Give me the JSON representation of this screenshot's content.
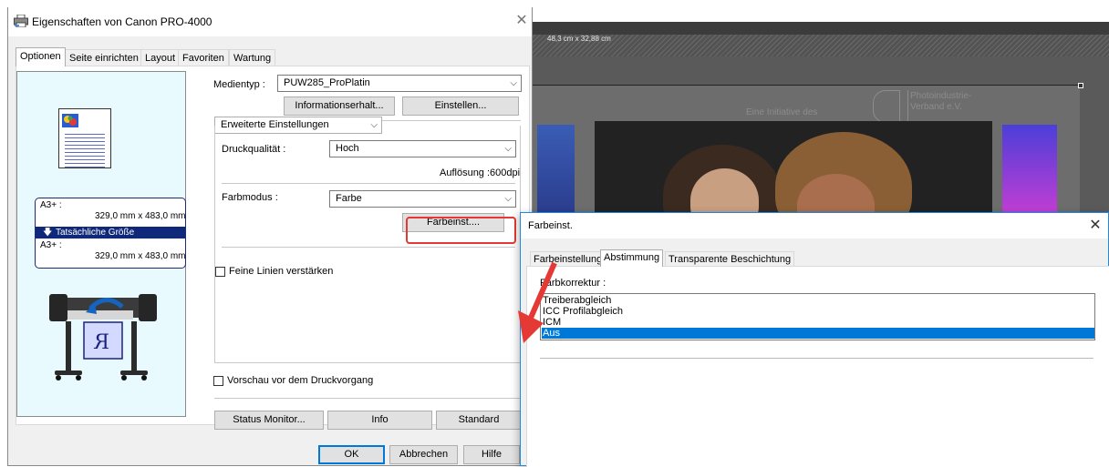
{
  "background": {
    "canvas_size": "48,3 cm x 32,88 cm",
    "slogan": "Eine Initiative des",
    "brand_line1": "Photoindustrie-",
    "brand_line2": "Verband e.V."
  },
  "properties_dialog": {
    "title": "Eigenschaften von Canon PRO-4000",
    "tabs": [
      "Optionen",
      "Seite einrichten",
      "Layout",
      "Favoriten",
      "Wartung"
    ],
    "active_tab": "Optionen",
    "preview": {
      "paper_label_1": "A3+ :",
      "paper_size_1": "329,0 mm x 483,0 mm",
      "scaling": "Tatsächliche Größe",
      "paper_label_2": "A3+ :",
      "paper_size_2": "329,0 mm x 483,0 mm"
    },
    "media_type_label": "Medientyp :",
    "media_type_value": "PUW285_ProPlatin",
    "info_button": "Informationserhalt...",
    "set_button": "Einstellen...",
    "settings_mode": "Erweiterte Einstellungen",
    "quality_label": "Druckqualität :",
    "quality_value": "Hoch",
    "resolution": "Auflösung :600dpi",
    "color_mode_label": "Farbmodus :",
    "color_mode_value": "Farbe",
    "color_settings_button": "Farbeinst....",
    "fine_lines_label": "Feine Linien verstärken",
    "fine_lines_checked": false,
    "preview_before_print_label": "Vorschau vor dem Druckvorgang",
    "preview_before_print_checked": false,
    "status_monitor_button": "Status Monitor...",
    "info_button_2": "Info",
    "standard_button": "Standard",
    "ok_button": "OK",
    "cancel_button": "Abbrechen",
    "help_button": "Hilfe"
  },
  "color_dialog": {
    "title": "Farbeinst.",
    "tabs": [
      "Farbeinstellung",
      "Abstimmung",
      "Transparente Beschichtung"
    ],
    "active_tab": "Abstimmung",
    "correction_label": "Farbkorrektur :",
    "options": [
      "Treiberabgleich",
      "ICC Profilabgleich",
      "ICM",
      "Aus"
    ],
    "selected_option": "Aus"
  },
  "colors": {
    "selection": "#0078d7",
    "highlight": "#e53935",
    "preview_bg": "#e9fafe",
    "scaling_row": "#10287a"
  }
}
